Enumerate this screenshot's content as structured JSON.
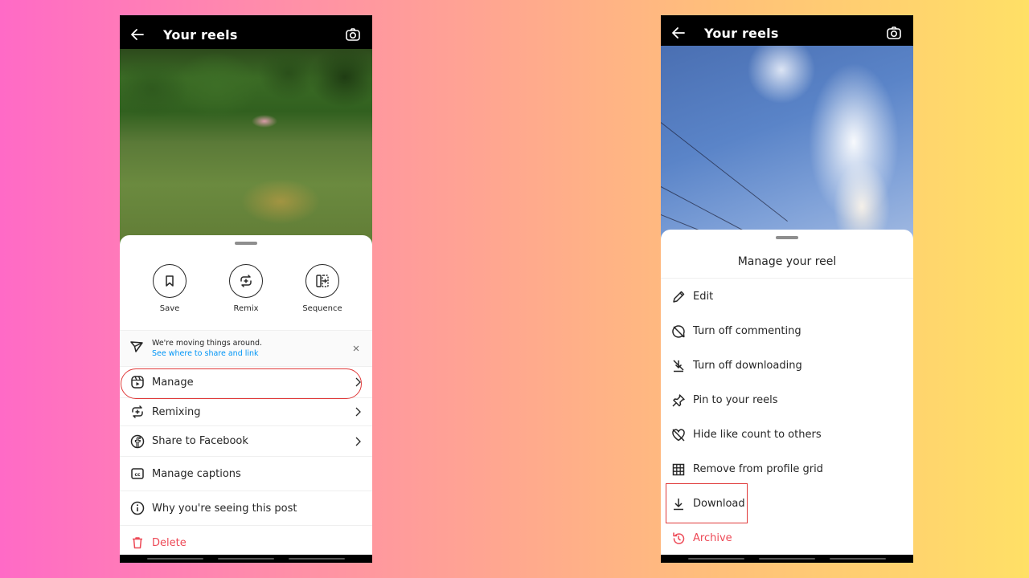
{
  "left_phone": {
    "header": {
      "title": "Your reels"
    },
    "quick_actions": [
      {
        "label": "Save",
        "icon": "bookmark-icon"
      },
      {
        "label": "Remix",
        "icon": "remix-icon"
      },
      {
        "label": "Sequence",
        "icon": "sequence-icon"
      }
    ],
    "notice": {
      "title": "We're moving things around.",
      "link": "See where to share and link"
    },
    "menu": [
      {
        "label": "Manage",
        "icon": "reels-icon",
        "chevron": true
      },
      {
        "label": "Remixing",
        "icon": "remix-icon",
        "chevron": true
      },
      {
        "label": "Share to Facebook",
        "icon": "facebook-icon",
        "chevron": true
      },
      {
        "label": "Manage captions",
        "icon": "captions-icon",
        "chevron": false
      },
      {
        "label": "Why you're seeing this post",
        "icon": "info-icon",
        "chevron": false
      },
      {
        "label": "Delete",
        "icon": "trash-icon",
        "chevron": false
      }
    ],
    "highlighted_item": "Manage"
  },
  "right_phone": {
    "header": {
      "title": "Your reels"
    },
    "sheet_title": "Manage your reel",
    "menu": [
      {
        "label": "Edit",
        "icon": "pencil-icon"
      },
      {
        "label": "Turn off commenting",
        "icon": "comment-off-icon"
      },
      {
        "label": "Turn off downloading",
        "icon": "download-off-icon"
      },
      {
        "label": "Pin to your reels",
        "icon": "pin-icon"
      },
      {
        "label": "Hide like count to others",
        "icon": "heart-off-icon"
      },
      {
        "label": "Remove from profile grid",
        "icon": "grid-icon"
      },
      {
        "label": "Download",
        "icon": "download-icon"
      },
      {
        "label": "Archive",
        "icon": "archive-icon"
      }
    ],
    "highlighted_item": "Download"
  },
  "colors": {
    "danger": "#ed4956",
    "link": "#0095f6",
    "highlight": "#e03a3a"
  }
}
